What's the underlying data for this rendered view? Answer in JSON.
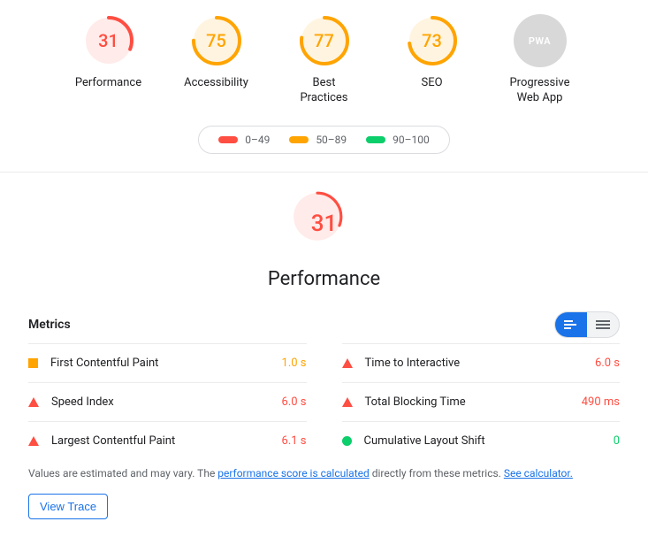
{
  "colors": {
    "fail": "#ff4e42",
    "average": "#ffa400",
    "pass": "#0cce6b",
    "na": "#d8d8d8",
    "link": "#1a73e8"
  },
  "gauges": [
    {
      "id": "performance",
      "label": "Performance",
      "score": 31,
      "status": "fail"
    },
    {
      "id": "accessibility",
      "label": "Accessibility",
      "score": 75,
      "status": "average"
    },
    {
      "id": "best-practices",
      "label": "Best\nPractices",
      "score": 77,
      "status": "average"
    },
    {
      "id": "seo",
      "label": "SEO",
      "score": 73,
      "status": "average"
    },
    {
      "id": "pwa",
      "label": "Progressive\nWeb App",
      "score": null,
      "status": "na",
      "badge": "PWA"
    }
  ],
  "legend": {
    "fail": "0–49",
    "average": "50–89",
    "pass": "90–100"
  },
  "performance": {
    "section_title": "Performance",
    "score": 31,
    "status": "fail",
    "metrics_heading": "Metrics",
    "metrics": [
      {
        "name": "First Contentful Paint",
        "value": "1.0 s",
        "status": "average",
        "shape": "square"
      },
      {
        "name": "Time to Interactive",
        "value": "6.0 s",
        "status": "fail",
        "shape": "triangle"
      },
      {
        "name": "Speed Index",
        "value": "6.0 s",
        "status": "fail",
        "shape": "triangle"
      },
      {
        "name": "Total Blocking Time",
        "value": "490 ms",
        "status": "fail",
        "shape": "triangle"
      },
      {
        "name": "Largest Contentful Paint",
        "value": "6.1 s",
        "status": "fail",
        "shape": "triangle"
      },
      {
        "name": "Cumulative Layout Shift",
        "value": "0",
        "status": "pass",
        "shape": "circle"
      }
    ],
    "footnote_pre": "Values are estimated and may vary. The ",
    "footnote_link1": "performance score is calculated",
    "footnote_mid": " directly from these metrics. ",
    "footnote_link2": "See calculator.",
    "view_trace_label": "View Trace"
  },
  "chart_data": {
    "type": "gauge",
    "title": "Lighthouse category scores",
    "range": [
      0,
      100
    ],
    "thresholds": {
      "fail": [
        0,
        49
      ],
      "average": [
        50,
        89
      ],
      "pass": [
        90,
        100
      ]
    },
    "series": [
      {
        "name": "Performance",
        "value": 31
      },
      {
        "name": "Accessibility",
        "value": 75
      },
      {
        "name": "Best Practices",
        "value": 77
      },
      {
        "name": "SEO",
        "value": 73
      },
      {
        "name": "Progressive Web App",
        "value": null
      }
    ]
  }
}
